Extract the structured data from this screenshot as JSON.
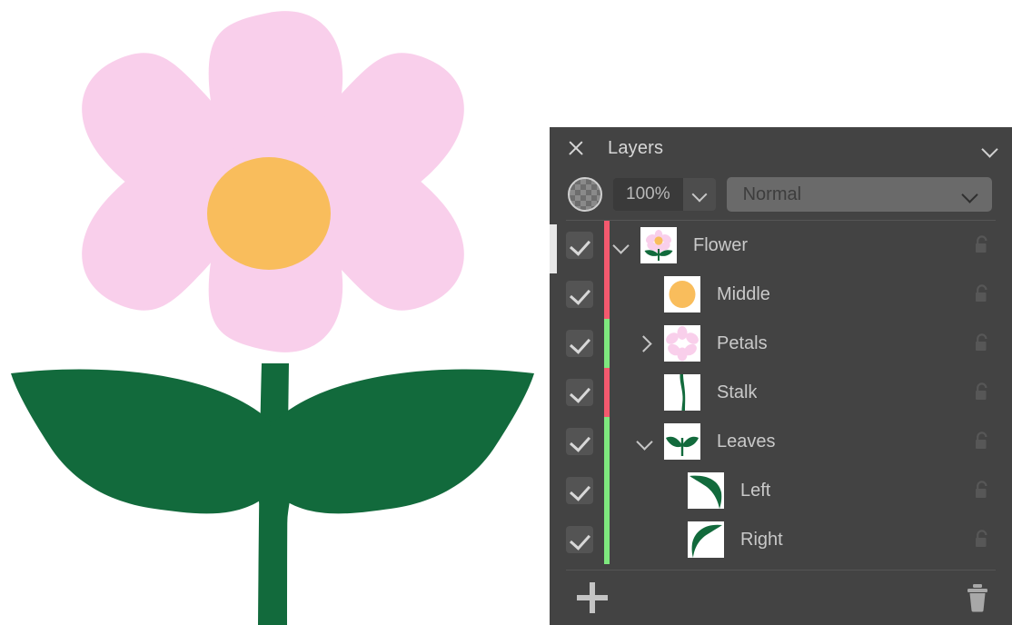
{
  "panel": {
    "title": "Layers",
    "close_icon": "close-icon",
    "collapse_icon": "chevron-down-icon"
  },
  "toolbar": {
    "alpha_icon": "transparency-checker-icon",
    "opacity_value": "100%",
    "opacity_dropdown_icon": "chevron-down-icon",
    "blend_mode": "Normal",
    "blend_dropdown_icon": "chevron-down-icon"
  },
  "colors": {
    "panel_bg": "#434343",
    "text": "#c9c9c9",
    "title_text": "#d7d7d7",
    "marker_red": "#f4596e",
    "marker_green": "#7ee87e",
    "petal_pink": "#f9cfeb",
    "center_orange": "#f9bd5c",
    "leaf_green": "#126a3c",
    "checkbox_bg": "#545454",
    "blend_select_bg": "#6a6a6a"
  },
  "layers": [
    {
      "name": "Flower",
      "visible": true,
      "indent": 0,
      "twisty": "open",
      "marker": "#f4596e",
      "thumb": "flower-full",
      "lock_icon": "unlock-icon",
      "locked": false
    },
    {
      "name": "Middle",
      "visible": true,
      "indent": 1,
      "twisty": "none",
      "marker": "#f4596e",
      "thumb": "circle-orange",
      "lock_icon": "unlock-icon",
      "locked": false
    },
    {
      "name": "Petals",
      "visible": true,
      "indent": 1,
      "twisty": "closed",
      "marker": "#7ee87e",
      "thumb": "petals",
      "lock_icon": "unlock-icon",
      "locked": false
    },
    {
      "name": "Stalk",
      "visible": true,
      "indent": 1,
      "twisty": "none",
      "marker": "#f4596e",
      "thumb": "stalk",
      "lock_icon": "unlock-icon",
      "locked": false
    },
    {
      "name": "Leaves",
      "visible": true,
      "indent": 1,
      "twisty": "open",
      "marker": "#7ee87e",
      "thumb": "leaves-pair",
      "lock_icon": "unlock-icon",
      "locked": false
    },
    {
      "name": "Left",
      "visible": true,
      "indent": 2,
      "twisty": "none",
      "marker": "#7ee87e",
      "thumb": "leaf-left",
      "lock_icon": "unlock-icon",
      "locked": false
    },
    {
      "name": "Right",
      "visible": true,
      "indent": 2,
      "twisty": "none",
      "marker": "#7ee87e",
      "thumb": "leaf-right",
      "lock_icon": "unlock-icon",
      "locked": false
    }
  ],
  "footer": {
    "add_icon": "plus-icon",
    "delete_icon": "trash-icon"
  },
  "canvas": {
    "artwork": "pink-daisy-flower-with-two-leaves"
  }
}
